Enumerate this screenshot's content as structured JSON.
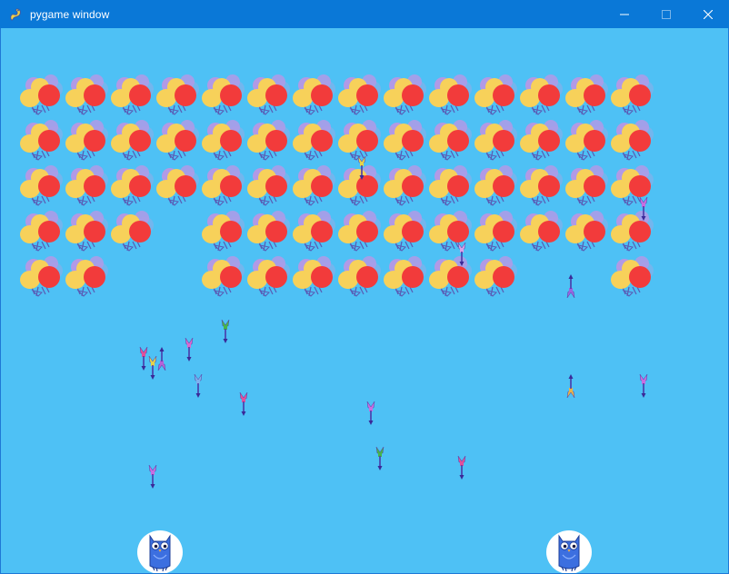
{
  "window": {
    "title": "pygame window",
    "app_icon": "pygame-snake-icon",
    "titlebar_color": "#0a78d7",
    "controls": [
      "minimize-icon",
      "maximize-icon",
      "close-icon"
    ]
  },
  "game": {
    "background_color": "#4ec1f5",
    "balloon_grid": {
      "columns": 14,
      "rows": [
        [
          1,
          1,
          1,
          1,
          1,
          1,
          1,
          1,
          1,
          1,
          1,
          1,
          1,
          1
        ],
        [
          1,
          1,
          1,
          1,
          1,
          1,
          1,
          1,
          1,
          1,
          1,
          1,
          1,
          1
        ],
        [
          1,
          1,
          1,
          1,
          1,
          1,
          1,
          1,
          1,
          1,
          1,
          1,
          1,
          1
        ],
        [
          1,
          1,
          1,
          0,
          1,
          1,
          1,
          1,
          1,
          1,
          1,
          1,
          1,
          1
        ],
        [
          1,
          1,
          0,
          0,
          1,
          1,
          1,
          1,
          1,
          1,
          1,
          0,
          0,
          1
        ]
      ]
    },
    "balloon_colors": {
      "front": "#f23b3b",
      "yellow": "#f7d15a",
      "purple": "#b19ae6",
      "blue": "#73b6ee",
      "string": "#5a5ab4"
    },
    "darts": [
      {
        "color": "#e3509a",
        "heading": "down"
      },
      {
        "color": "#e6d34a",
        "heading": "down"
      },
      {
        "color": "#b462d8",
        "heading": "up"
      },
      {
        "color": "#d96ad0",
        "heading": "down"
      },
      {
        "color": "#46b54a",
        "heading": "down"
      },
      {
        "color": "#7db1ee",
        "heading": "down"
      },
      {
        "color": "#e3509a",
        "heading": "down"
      },
      {
        "color": "#c86ee0",
        "heading": "down"
      },
      {
        "color": "#46b54a",
        "heading": "down"
      },
      {
        "color": "#e3509a",
        "heading": "down"
      },
      {
        "color": "#c86ee0",
        "heading": "down"
      },
      {
        "color": "#9a66e0",
        "heading": "up"
      },
      {
        "color": "#e6b34a",
        "heading": "up"
      },
      {
        "color": "#c86ee0",
        "heading": "down"
      },
      {
        "color": "#e6d34a",
        "heading": "down"
      },
      {
        "color": "#d9a0e8",
        "heading": "down"
      },
      {
        "color": "#c86ee0",
        "heading": "down"
      }
    ],
    "players": [
      {
        "name": "owl-player-left",
        "body_color": "#3c6fe0"
      },
      {
        "name": "owl-player-right",
        "body_color": "#3c6fe0"
      }
    ]
  }
}
